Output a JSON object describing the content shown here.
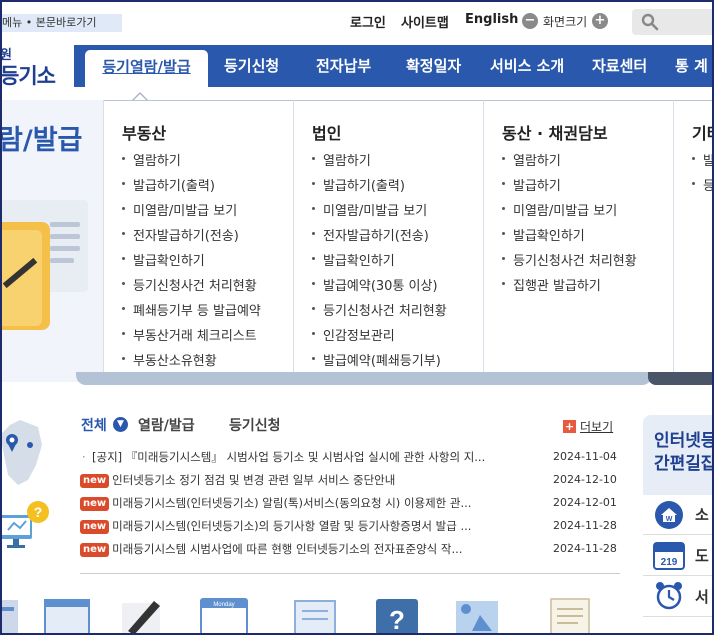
{
  "skip_link": "메뉴 • 본문바로가기",
  "utility": {
    "login": "로그인",
    "sitemap": "사이트맵",
    "english": "English",
    "zoom_label": "화면크기",
    "zoom_minus": "−",
    "zoom_plus": "+"
  },
  "logo": {
    "line1": "원",
    "line2": "등기소"
  },
  "nav": {
    "active": "등기열람/발급",
    "items": [
      "등기신청",
      "전자납부",
      "확정일자",
      "서비스 소개",
      "자료센터",
      "통 계"
    ]
  },
  "mega_menu": {
    "section_title": "람/발급",
    "columns": [
      {
        "heading": "부동산",
        "items": [
          "열람하기",
          "발급하기(출력)",
          "미열람/미발급 보기",
          "전자발급하기(전송)",
          "발급확인하기",
          "등기신청사건 처리현황",
          "폐쇄등기부 등 발급예약",
          "부동산거래 체크리스트",
          "부동산소유현황"
        ]
      },
      {
        "heading": "법인",
        "items": [
          "열람하기",
          "발급하기(출력)",
          "미열람/미발급 보기",
          "전자발급하기(전송)",
          "발급확인하기",
          "발급예약(30통 이상)",
          "등기신청사건 처리현황",
          "인감정보관리",
          "발급예약(폐쇄등기부)"
        ]
      },
      {
        "heading": "동산 · 채권담보",
        "items": [
          "열람하기",
          "발급하기",
          "미열람/미발급 보기",
          "발급확인하기",
          "등기신청사건 처리현황",
          "집행관 발급하기"
        ]
      },
      {
        "heading": "기타",
        "items": [
          "발",
          "등"
        ]
      }
    ]
  },
  "news": {
    "tabs": {
      "all": "전체",
      "view_issue": "열람/발급",
      "apply": "등기신청"
    },
    "more": "더보기",
    "items": [
      {
        "badge": "",
        "title": "[공지] 『미래등기시스템』 시범사업 등기소 및 시범사업 실시에 관한 사항의 지...",
        "date": "2024-11-04"
      },
      {
        "badge": "new",
        "title": "인터넷등기소 정기 점검 및 변경 관련 일부 서비스 중단안내",
        "date": "2024-12-10"
      },
      {
        "badge": "new",
        "title": "미래등기시스템(인터넷등기소) 알림(톡)서비스(동의요청 시) 이용제한 관...",
        "date": "2024-12-01"
      },
      {
        "badge": "new",
        "title": "미래등기시스템(인터넷등기소)의 등기사항 열람 및 등기사항증명서 발급 ...",
        "date": "2024-11-28"
      },
      {
        "badge": "new",
        "title": "미래등기시스템 시범사업에 따른 현행 인터넷등기소의 전자표준양식 작...",
        "date": "2024-11-28"
      }
    ]
  },
  "quick": {
    "title_line1": "인터넷등",
    "title_line2": "간편길잡",
    "items": [
      {
        "label": "소",
        "icon": "house-icon"
      },
      {
        "label": "도",
        "icon": "address-sign-icon",
        "number": "219"
      },
      {
        "label": "서",
        "icon": "alarm-clock-icon"
      }
    ]
  },
  "bottom_icons": [
    "sidebar-window-icon",
    "browser-window-icon",
    "pen-icon",
    "calendar-icon",
    "document-icon",
    "question-icon",
    "presentation-icon",
    "certificate-icon"
  ],
  "calendar_label": "Monday",
  "colors": {
    "primary": "#2a58ad",
    "new_badge": "#d94b2b"
  }
}
